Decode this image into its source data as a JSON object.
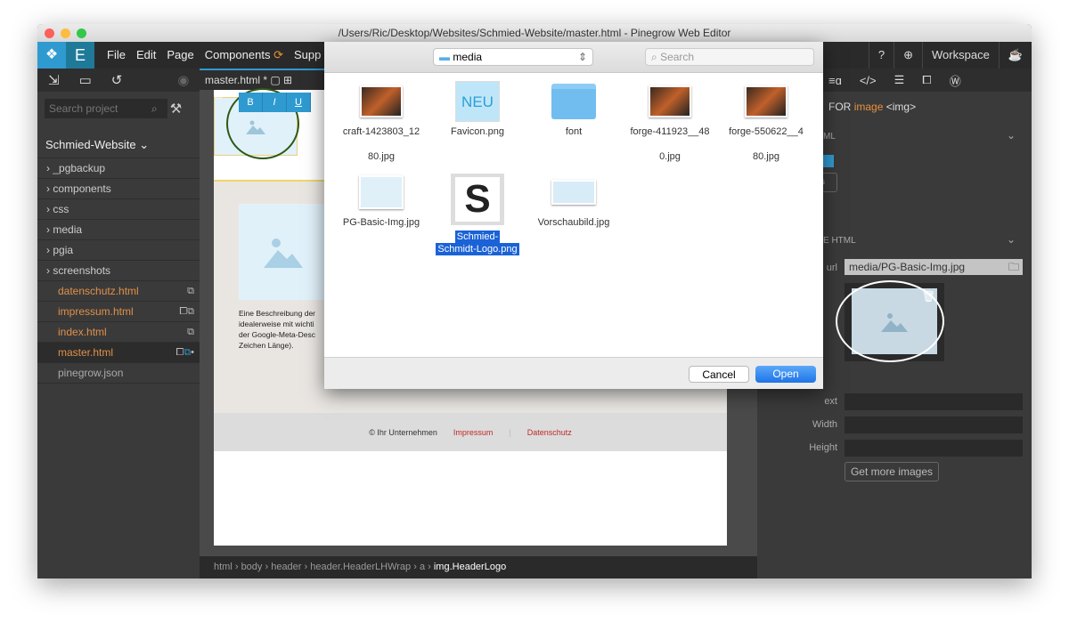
{
  "window": {
    "title": "/Users/Ric/Desktop/Websites/Schmied-Website/master.html - Pinegrow Web Editor"
  },
  "menu": [
    "File",
    "Edit",
    "Page",
    "Components",
    "Supp"
  ],
  "topright": {
    "workspace": "Workspace"
  },
  "sidebar": {
    "search_placeholder": "Search project",
    "project": "Schmied-Website",
    "folders": [
      "_pgbackup",
      "components",
      "css",
      "media",
      "pgia",
      "screenshots"
    ],
    "files": [
      "datenschutz.html",
      "impressum.html",
      "index.html",
      "master.html"
    ],
    "other": "pinegrow.json"
  },
  "tab": {
    "label": "master.html *"
  },
  "format": [
    "B",
    "I",
    "U"
  ],
  "page": {
    "desc": [
      "Eine Beschreibung der",
      "idealerweise mit wichti",
      "der Google-Meta-Desc",
      "Zeichen Länge)."
    ],
    "footer": {
      "copy": "© Ihr Unternehmen",
      "impressum": "Impressum",
      "datenschutz": "Datenschutz"
    }
  },
  "breadcrumb": [
    "html",
    "body",
    "header",
    "header.HeaderLHWrap",
    "a",
    "img.HeaderLogo"
  ],
  "right": {
    "header_prefix": "FOR",
    "header_element": "image",
    "header_tag": "<img>",
    "sec1": "ML",
    "sec2_prefix": "E",
    "sec2": "HTML",
    "url_label": "url",
    "url_value": "media/PG-Basic-Img.jpg",
    "alt_label": "ext",
    "width_label": "Width",
    "height_label": "Height",
    "more_button": "Get more images"
  },
  "dialog": {
    "folder": "media",
    "search_placeholder": "Search",
    "files": [
      {
        "name": "craft-1423803_1280.jpg",
        "l1": "craft-1423803_12",
        "l2": "80.jpg",
        "kind": "photo"
      },
      {
        "name": "Favicon.png",
        "l1": "Favicon.png",
        "l2": "",
        "kind": "neu",
        "thumb_text": "NEU"
      },
      {
        "name": "font",
        "l1": "font",
        "l2": "",
        "kind": "folder"
      },
      {
        "name": "forge-411923__480.jpg",
        "l1": "forge-411923__48",
        "l2": "0.jpg",
        "kind": "photo"
      },
      {
        "name": "forge-550622__480.jpg",
        "l1": "forge-550622__4",
        "l2": "80.jpg",
        "kind": "photo"
      },
      {
        "name": "PG-Basic-Img.jpg",
        "l1": "PG-Basic-Img.jpg",
        "l2": "",
        "kind": "placeholder"
      },
      {
        "name": "Schmied-Schmidt-Logo.png",
        "l1": "Schmied-",
        "l2": "Schmidt-Logo.png",
        "kind": "logo",
        "selected": true
      },
      {
        "name": "Vorschaubild.jpg",
        "l1": "Vorschaubild.jpg",
        "l2": "",
        "kind": "preview"
      }
    ],
    "cancel": "Cancel",
    "open": "Open"
  },
  "colors": {
    "accent": "#2f9ad0",
    "file": "#e0904a",
    "link": "#c0282a",
    "select": "#1a62d6"
  }
}
